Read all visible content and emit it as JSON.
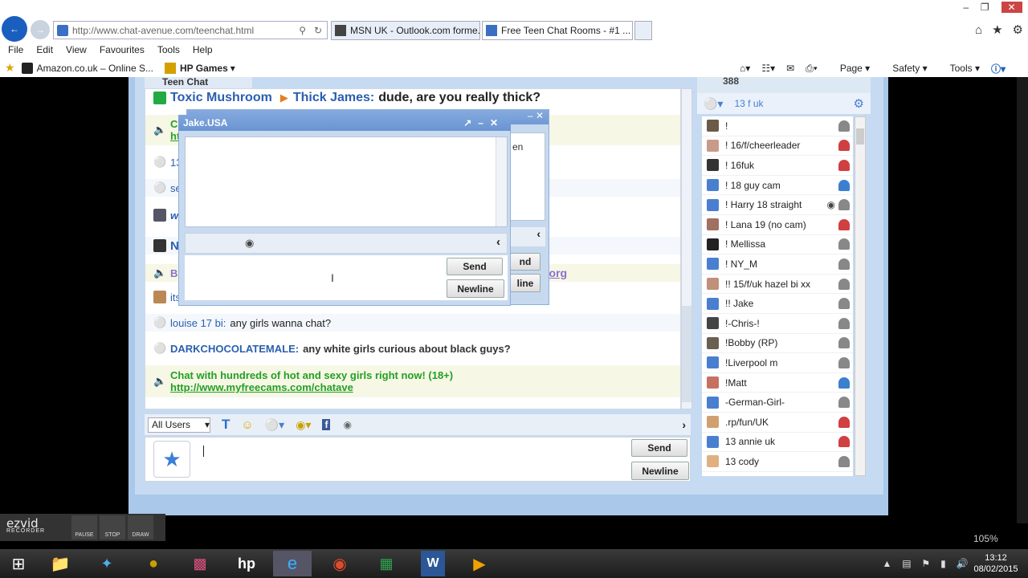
{
  "browser": {
    "url": "http://www.chat-avenue.com/teenchat.html",
    "tabs": [
      {
        "label": "MSN UK - Outlook.com forme..."
      },
      {
        "label": "Free Teen Chat Rooms - #1 ..."
      }
    ],
    "menu": [
      "File",
      "Edit",
      "View",
      "Favourites",
      "Tools",
      "Help"
    ],
    "favourites": [
      {
        "label": "Amazon.co.uk – Online S..."
      },
      {
        "label": "HP Games"
      }
    ],
    "commands": [
      "Page",
      "Safety",
      "Tools"
    ]
  },
  "chat": {
    "room_label": "Teen Chat",
    "messages": [
      {
        "from": "Toxic Mushroom",
        "to": "Thick James:",
        "text": "dude, are you really thick?"
      },
      {
        "prefix": "C"
      },
      {
        "prefix": "ht"
      },
      {
        "prefix": "13"
      },
      {
        "prefix": "se"
      },
      {
        "prefix": "w"
      },
      {
        "prefix": "N"
      },
      {
        "prefix": "B"
      },
      {
        "prefix": "its"
      },
      {
        "from": "louise 17 bi:",
        "text": "any girls wanna chat?"
      },
      {
        "from": "DARKCHOCOLATEMALE:",
        "text": "any white girls curious about black guys?"
      },
      {
        "promo": "Chat with hundreds of hot and sexy girls right now! (18+)",
        "link": "http://www.myfreecams.com/chatave"
      }
    ],
    "hidden_fragments": {
      "link_tail": "t.org",
      "en": "en",
      "nd": "nd",
      "line": "line"
    },
    "user_select": "All Users",
    "send_label": "Send",
    "newline_label": "Newline"
  },
  "userlist": {
    "count_partial": "388",
    "search_value": "13 f uk",
    "users": [
      {
        "name": "!",
        "gender": "none"
      },
      {
        "name": "!  16/f/cheerleader",
        "gender": "female"
      },
      {
        "name": "!  16fuk",
        "gender": "female"
      },
      {
        "name": "! 18 guy cam",
        "gender": "male"
      },
      {
        "name": "! Harry 18 straight",
        "gender": "none",
        "cam": true
      },
      {
        "name": "! Lana 19 (no cam)",
        "gender": "female"
      },
      {
        "name": "! Mellissa",
        "gender": "none"
      },
      {
        "name": "! NY_M",
        "gender": "none"
      },
      {
        "name": "!! 15/f/uk hazel bi xx",
        "gender": "none"
      },
      {
        "name": "!! Jake",
        "gender": "none"
      },
      {
        "name": "!-Chris-!",
        "gender": "none"
      },
      {
        "name": "!Bobby (RP)",
        "gender": "none"
      },
      {
        "name": "!Liverpool m",
        "gender": "none"
      },
      {
        "name": "!Matt",
        "gender": "male"
      },
      {
        "name": "-German-Girl-",
        "gender": "none"
      },
      {
        "name": ".rp/fun/UK",
        "gender": "female"
      },
      {
        "name": "13 annie uk",
        "gender": "female"
      },
      {
        "name": "13 cody",
        "gender": "none"
      }
    ]
  },
  "private_message": {
    "title": "Jake.USA",
    "send_label": "Send",
    "newline_label": "Newline"
  },
  "ezvid": {
    "logo": "ezvid",
    "sub": "RECORDER",
    "buttons": [
      "PAUSE",
      "STOP",
      "DRAW"
    ]
  },
  "statusbar": {
    "zoom": "105%"
  },
  "taskbar": {
    "time": "13:12",
    "date": "08/02/2015"
  },
  "colors": {
    "accent": "#2a5fb0",
    "promo": "#22a022",
    "frame": "#a9c8ea"
  }
}
